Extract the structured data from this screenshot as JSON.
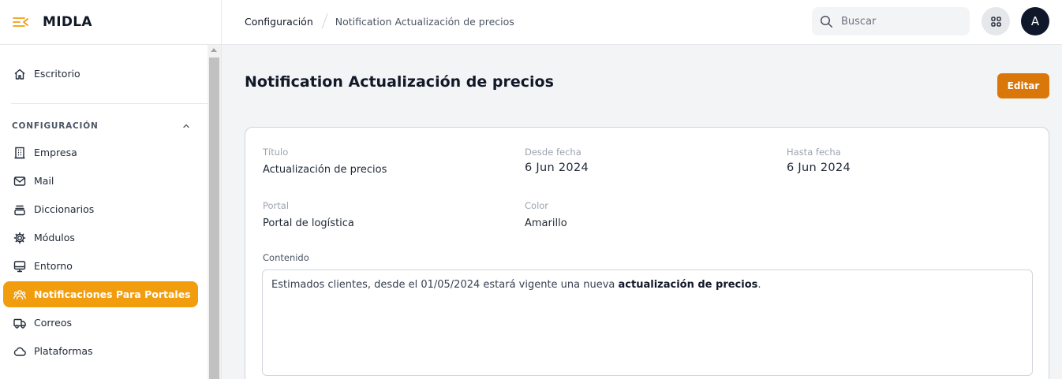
{
  "app": {
    "name": "MIDLA",
    "accent": "#f29d0e"
  },
  "sidebar": {
    "home": {
      "label": "Escritorio",
      "icon": "home-icon"
    },
    "section": {
      "title": "CONFIGURACIÓN",
      "icon": "chevron-up-icon"
    },
    "items": [
      {
        "label": "Empresa",
        "icon": "building-icon",
        "active": false
      },
      {
        "label": "Mail",
        "icon": "mail-icon",
        "active": false
      },
      {
        "label": "Diccionarios",
        "icon": "stack-icon",
        "active": false
      },
      {
        "label": "Módulos",
        "icon": "gear-icon",
        "active": false
      },
      {
        "label": "Entorno",
        "icon": "monitor-icon",
        "active": false
      },
      {
        "label": "Notificaciones Para Portales",
        "icon": "users-icon",
        "active": true
      },
      {
        "label": "Correos",
        "icon": "truck-icon",
        "active": false
      },
      {
        "label": "Plataformas",
        "icon": "cloud-icon",
        "active": false
      }
    ]
  },
  "header": {
    "breadcrumb": [
      "Configuración",
      "Notification Actualización de precios"
    ],
    "search_placeholder": "Buscar",
    "avatar_initial": "A"
  },
  "main": {
    "title": "Notification Actualización de precios",
    "edit_label": "Editar",
    "fields": {
      "titulo": {
        "label": "Título",
        "value": "Actualización de precios"
      },
      "desde": {
        "label": "Desde fecha",
        "value": "6 Jun 2024"
      },
      "hasta": {
        "label": "Hasta fecha",
        "value": "6 Jun 2024"
      },
      "portal": {
        "label": "Portal",
        "value": "Portal de logística"
      },
      "color": {
        "label": "Color",
        "value": "Amarillo"
      }
    },
    "content": {
      "label": "Contenido",
      "text_before": "Estimados clientes, desde el 01/05/2024 estará vigente una nueva ",
      "text_bold": "actualización de precios",
      "text_after": "."
    }
  }
}
